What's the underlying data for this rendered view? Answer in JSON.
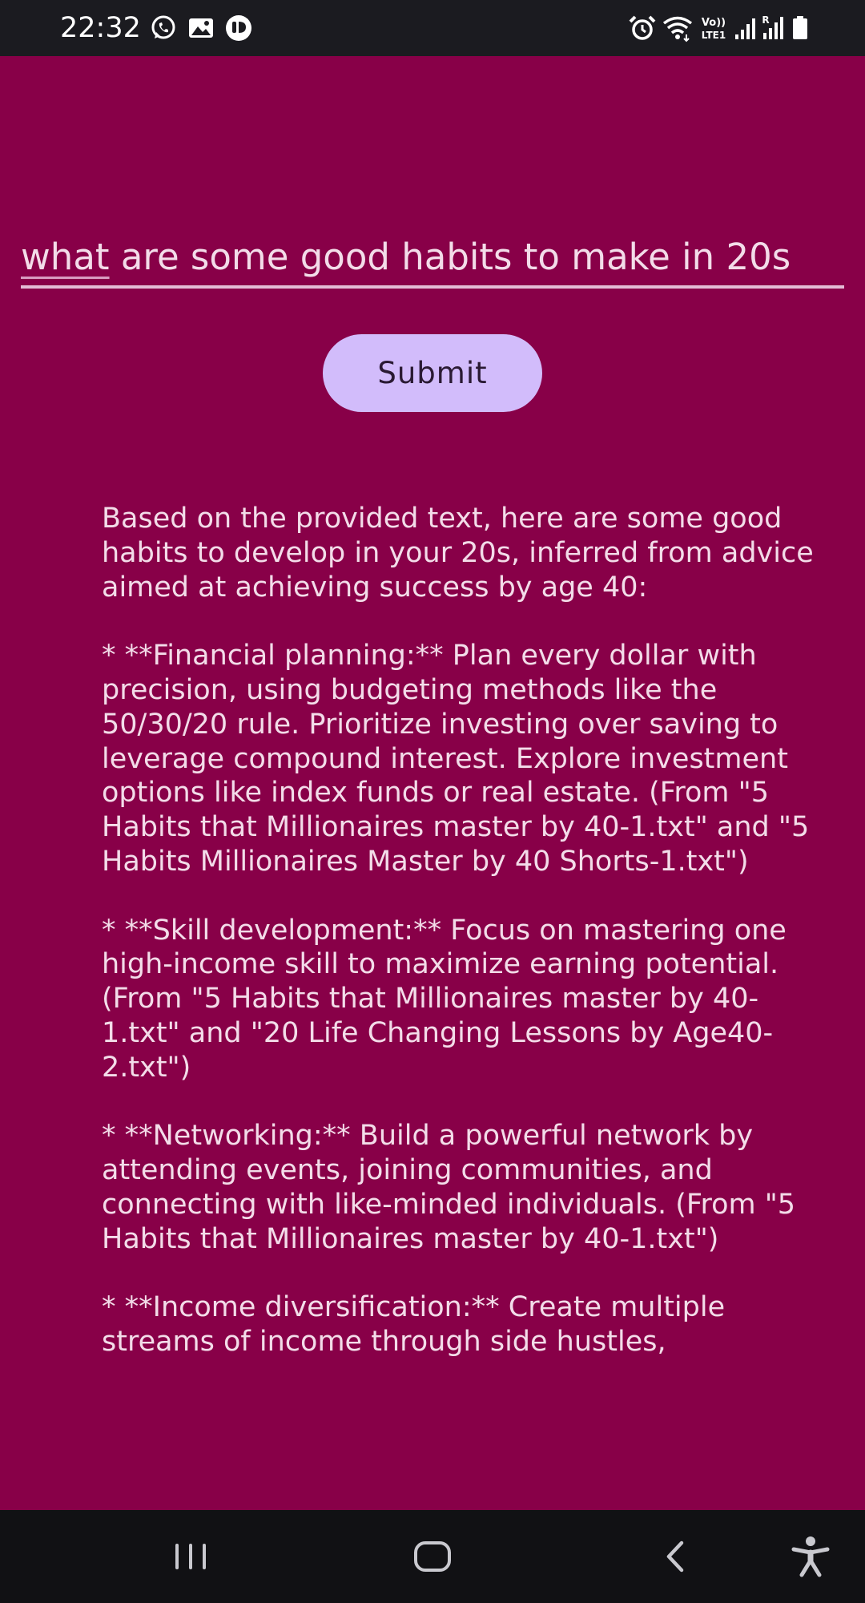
{
  "status_bar": {
    "time": "22:32",
    "left_icons": [
      "whatsapp-icon",
      "gallery-icon",
      "app-notification-icon"
    ],
    "right_icons": [
      "alarm-icon",
      "wifi-icon",
      "volte-icon",
      "signal-icon",
      "signal-roaming-icon",
      "battery-icon"
    ],
    "volte_label": "Vo)) LTE1",
    "roaming_label": "R"
  },
  "query": {
    "first_word": "what",
    "rest": " are some good habits to make in 20s"
  },
  "submit": {
    "label": "Submit"
  },
  "response": {
    "paragraphs": [
      "Based on the provided text, here are some good habits to develop in your 20s, inferred from advice aimed at achieving success by age 40:",
      "* **Financial planning:** Plan every dollar with precision, using budgeting methods like the 50/30/20 rule. Prioritize investing over saving to leverage compound interest. Explore investment options like index funds or real estate. (From \"5 Habits that Millionaires master by 40-1.txt\" and \"5 Habits Millionaires Master by 40  Shorts-1.txt\")",
      "* **Skill development:** Focus on mastering one high-income skill to maximize earning potential. (From \"5 Habits that Millionaires master by 40-1.txt\" and \"20 Life Changing Lessons by Age40-2.txt\")",
      "* **Networking:** Build a powerful network by attending events, joining communities, and connecting with like-minded individuals. (From \"5 Habits that Millionaires master by 40-1.txt\")",
      "* **Income diversification:** Create multiple streams of income through side hustles,"
    ]
  },
  "nav_bar": {
    "buttons": [
      "recent-apps-icon",
      "home-icon",
      "back-icon",
      "accessibility-icon"
    ]
  },
  "colors": {
    "background": "#880048",
    "text": "#f3dce9",
    "button": "#d2bcfb",
    "status_bar": "#1b1b20",
    "nav_bar": "#111114"
  }
}
